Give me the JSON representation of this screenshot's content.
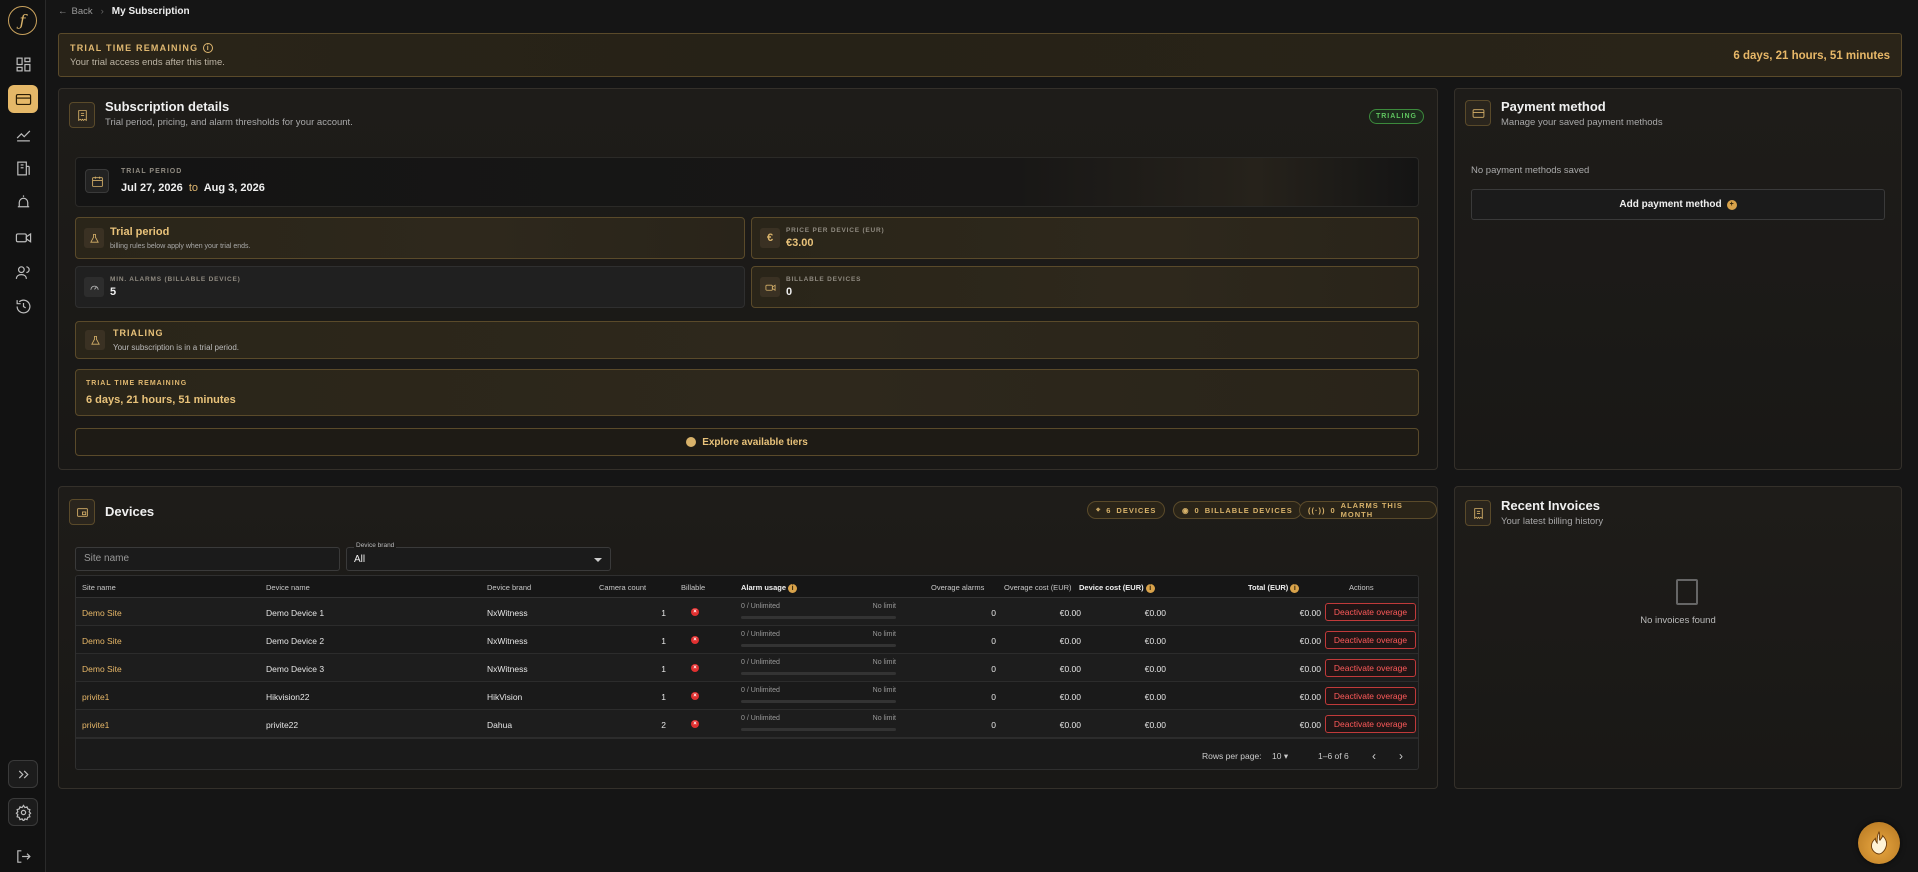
{
  "header": {
    "back_label": "Back",
    "breadcrumb_sep": "›",
    "page_title": "My Subscription"
  },
  "trial_banner": {
    "title": "TRIAL TIME REMAINING",
    "subtitle": "Your trial access ends after this time.",
    "remaining": "6 days, 21 hours, 51 minutes"
  },
  "subscription": {
    "title": "Subscription details",
    "subtitle": "Trial period, pricing, and alarm thresholds for your account.",
    "status_badge": "TRIALING",
    "period": {
      "label": "TRIAL PERIOD",
      "start": "Jul 27, 2026",
      "to": "to",
      "end": "Aug 3, 2026"
    },
    "plan": {
      "title": "Trial period",
      "subtitle": "billing rules below apply when your trial ends."
    },
    "price": {
      "label": "PRICE PER DEVICE (EUR)",
      "value": "€3.00"
    },
    "min_alarms": {
      "label": "MIN. ALARMS (BILLABLE DEVICE)",
      "value": "5"
    },
    "billable_devices": {
      "label": "BILLABLE DEVICES",
      "value": "0"
    },
    "status": {
      "title": "TRIALING",
      "subtitle": "Your subscription is in a trial period."
    },
    "remaining": {
      "label": "TRIAL TIME REMAINING",
      "value": "6 days, 21 hours, 51 minutes"
    },
    "explore_label": "Explore available tiers"
  },
  "payment": {
    "title": "Payment method",
    "subtitle": "Manage your saved payment methods",
    "empty": "No payment methods saved",
    "add_label": "Add payment method"
  },
  "devices": {
    "title": "Devices",
    "chips": [
      {
        "count": "6",
        "label": "DEVICES"
      },
      {
        "count": "0",
        "label": "BILLABLE DEVICES"
      },
      {
        "count": "0",
        "label": "ALARMS THIS MONTH"
      }
    ],
    "site_placeholder": "Site name",
    "brand_label": "Device brand",
    "brand_value": "All",
    "columns": [
      "Site name",
      "Device name",
      "Device brand",
      "Camera count",
      "Billable",
      "Alarm usage",
      "Overage alarms",
      "Overage cost (EUR)",
      "Device cost (EUR)",
      "Total (EUR)",
      "Actions"
    ],
    "rows": [
      {
        "site": "Demo Site",
        "device": "Demo Device 1",
        "brand": "NxWitness",
        "cameras": "1",
        "usage": "0 / Unlimited",
        "limit": "No limit",
        "overage_alarms": "0",
        "overage_cost": "€0.00",
        "device_cost": "€0.00",
        "total": "€0.00",
        "action": "Deactivate overage"
      },
      {
        "site": "Demo Site",
        "device": "Demo Device 2",
        "brand": "NxWitness",
        "cameras": "1",
        "usage": "0 / Unlimited",
        "limit": "No limit",
        "overage_alarms": "0",
        "overage_cost": "€0.00",
        "device_cost": "€0.00",
        "total": "€0.00",
        "action": "Deactivate overage"
      },
      {
        "site": "Demo Site",
        "device": "Demo Device 3",
        "brand": "NxWitness",
        "cameras": "1",
        "usage": "0 / Unlimited",
        "limit": "No limit",
        "overage_alarms": "0",
        "overage_cost": "€0.00",
        "device_cost": "€0.00",
        "total": "€0.00",
        "action": "Deactivate overage"
      },
      {
        "site": "privite1",
        "device": "Hikvision22",
        "brand": "HikVision",
        "cameras": "1",
        "usage": "0 / Unlimited",
        "limit": "No limit",
        "overage_alarms": "0",
        "overage_cost": "€0.00",
        "device_cost": "€0.00",
        "total": "€0.00",
        "action": "Deactivate overage"
      },
      {
        "site": "privite1",
        "device": "privite22",
        "brand": "Dahua",
        "cameras": "2",
        "usage": "0 / Unlimited",
        "limit": "No limit",
        "overage_alarms": "0",
        "overage_cost": "€0.00",
        "device_cost": "€0.00",
        "total": "€0.00",
        "action": "Deactivate overage"
      }
    ],
    "pagination": {
      "rows_label": "Rows per page:",
      "rows_value": "10",
      "range": "1–6 of 6"
    }
  },
  "invoices": {
    "title": "Recent Invoices",
    "subtitle": "Your latest billing history",
    "empty": "No invoices found"
  },
  "colors": {
    "accent": "#e5b868",
    "danger": "#e03030",
    "success": "#5fc45f",
    "background": "#151515"
  }
}
